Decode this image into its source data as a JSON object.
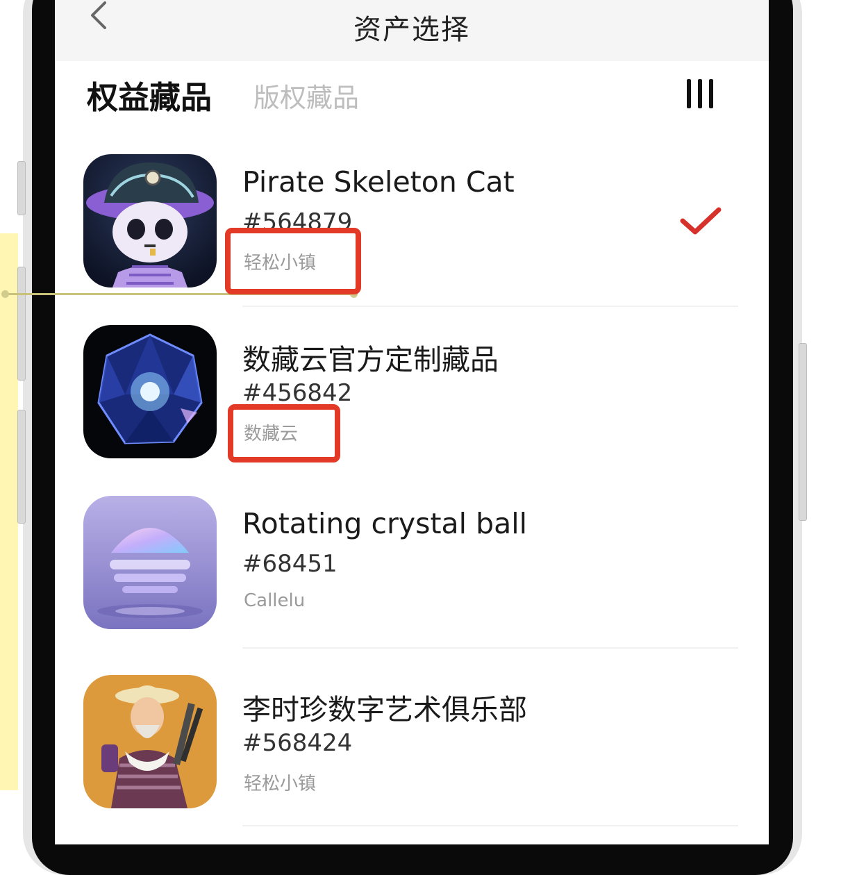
{
  "header": {
    "title": "资产选择"
  },
  "tabs": [
    {
      "label": "权益藏品",
      "active": true
    },
    {
      "label": "版权藏品",
      "active": false
    }
  ],
  "items": [
    {
      "name": "Pirate Skeleton Cat",
      "id": "#564879",
      "issuer": "轻松小镇",
      "selected": true,
      "image": "skeleton-cat-image"
    },
    {
      "name": "数藏云官方定制藏品",
      "id": "#456842",
      "issuer": "数藏云",
      "selected": false,
      "image": "crystal-gem-image"
    },
    {
      "name": "Rotating crystal ball",
      "id": "#68451",
      "issuer": "Callelu",
      "selected": false,
      "image": "crystal-ball-image"
    },
    {
      "name": "李时珍数字艺术俱乐部",
      "id": "#568424",
      "issuer": "轻松小镇",
      "selected": false,
      "image": "herbalist-portrait-image"
    }
  ],
  "icons": {
    "back": "back-chevron-icon",
    "menu": "menu-bars-icon",
    "selected": "checkmark-icon"
  },
  "colors": {
    "accent_red": "#e23a26",
    "check_red": "#d6312a",
    "annotation_yellow": "#fff6b3"
  }
}
